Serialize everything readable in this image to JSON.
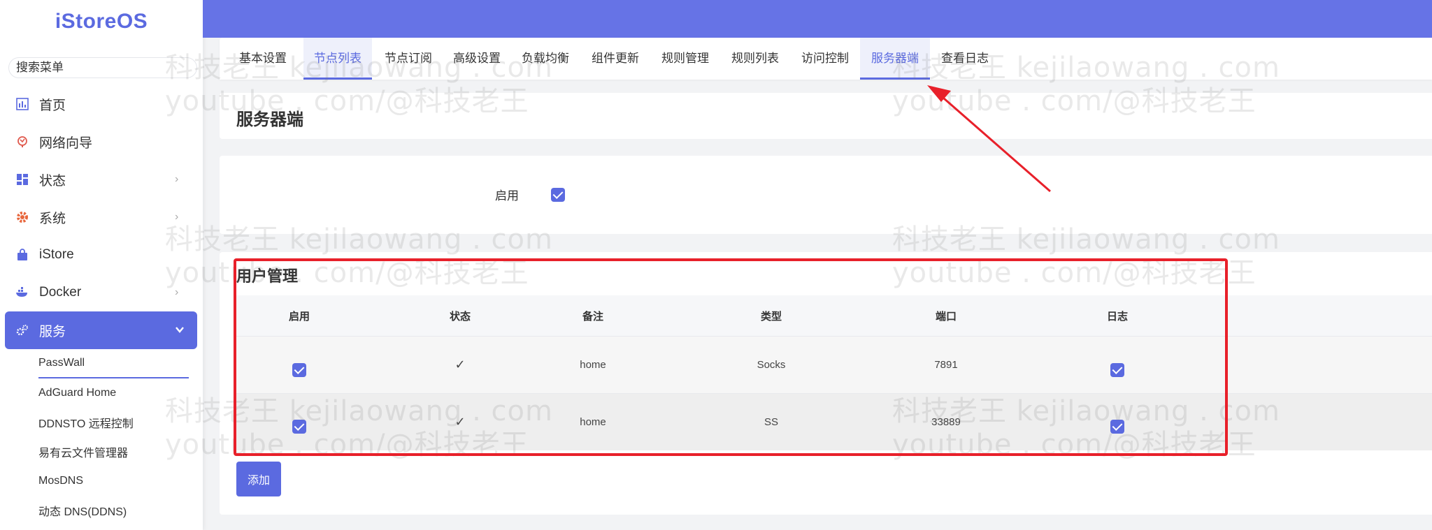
{
  "sidebar": {
    "logo": "iStoreOS",
    "search_placeholder": "搜索菜单",
    "items": [
      {
        "label": "首页"
      },
      {
        "label": "网络向导"
      },
      {
        "label": "状态"
      },
      {
        "label": "系统"
      },
      {
        "label": "iStore"
      },
      {
        "label": "Docker"
      },
      {
        "label": "服务"
      }
    ],
    "subitems": [
      {
        "label": "PassWall"
      },
      {
        "label": "AdGuard Home"
      },
      {
        "label": "DDNSTO 远程控制"
      },
      {
        "label": "易有云文件管理器"
      },
      {
        "label": "MosDNS"
      },
      {
        "label": "动态 DNS(DDNS)"
      }
    ]
  },
  "tabs": [
    {
      "label": "基本设置"
    },
    {
      "label": "节点列表"
    },
    {
      "label": "节点订阅"
    },
    {
      "label": "高级设置"
    },
    {
      "label": "负载均衡"
    },
    {
      "label": "组件更新"
    },
    {
      "label": "规则管理"
    },
    {
      "label": "规则列表"
    },
    {
      "label": "访问控制"
    },
    {
      "label": "服务器端"
    },
    {
      "label": "查看日志"
    }
  ],
  "page_title": "服务器端",
  "enable_label": "启用",
  "users": {
    "title": "用户管理",
    "columns": [
      "启用",
      "状态",
      "备注",
      "类型",
      "端口",
      "日志"
    ],
    "rows": [
      {
        "enabled": true,
        "status": "✓",
        "remark": "home",
        "type": "Socks",
        "port": "7891",
        "log": true
      },
      {
        "enabled": true,
        "status": "✓",
        "remark": "home",
        "type": "SS",
        "port": "33889",
        "log": true
      }
    ],
    "add_label": "添加"
  },
  "watermark": {
    "line1": "科技老王 kejilaowang . com",
    "line2": "youtube . com/@科技老王"
  },
  "colors": {
    "accent": "#5b6ae0",
    "topbar": "#6673e6",
    "annotation": "#e8202a"
  }
}
